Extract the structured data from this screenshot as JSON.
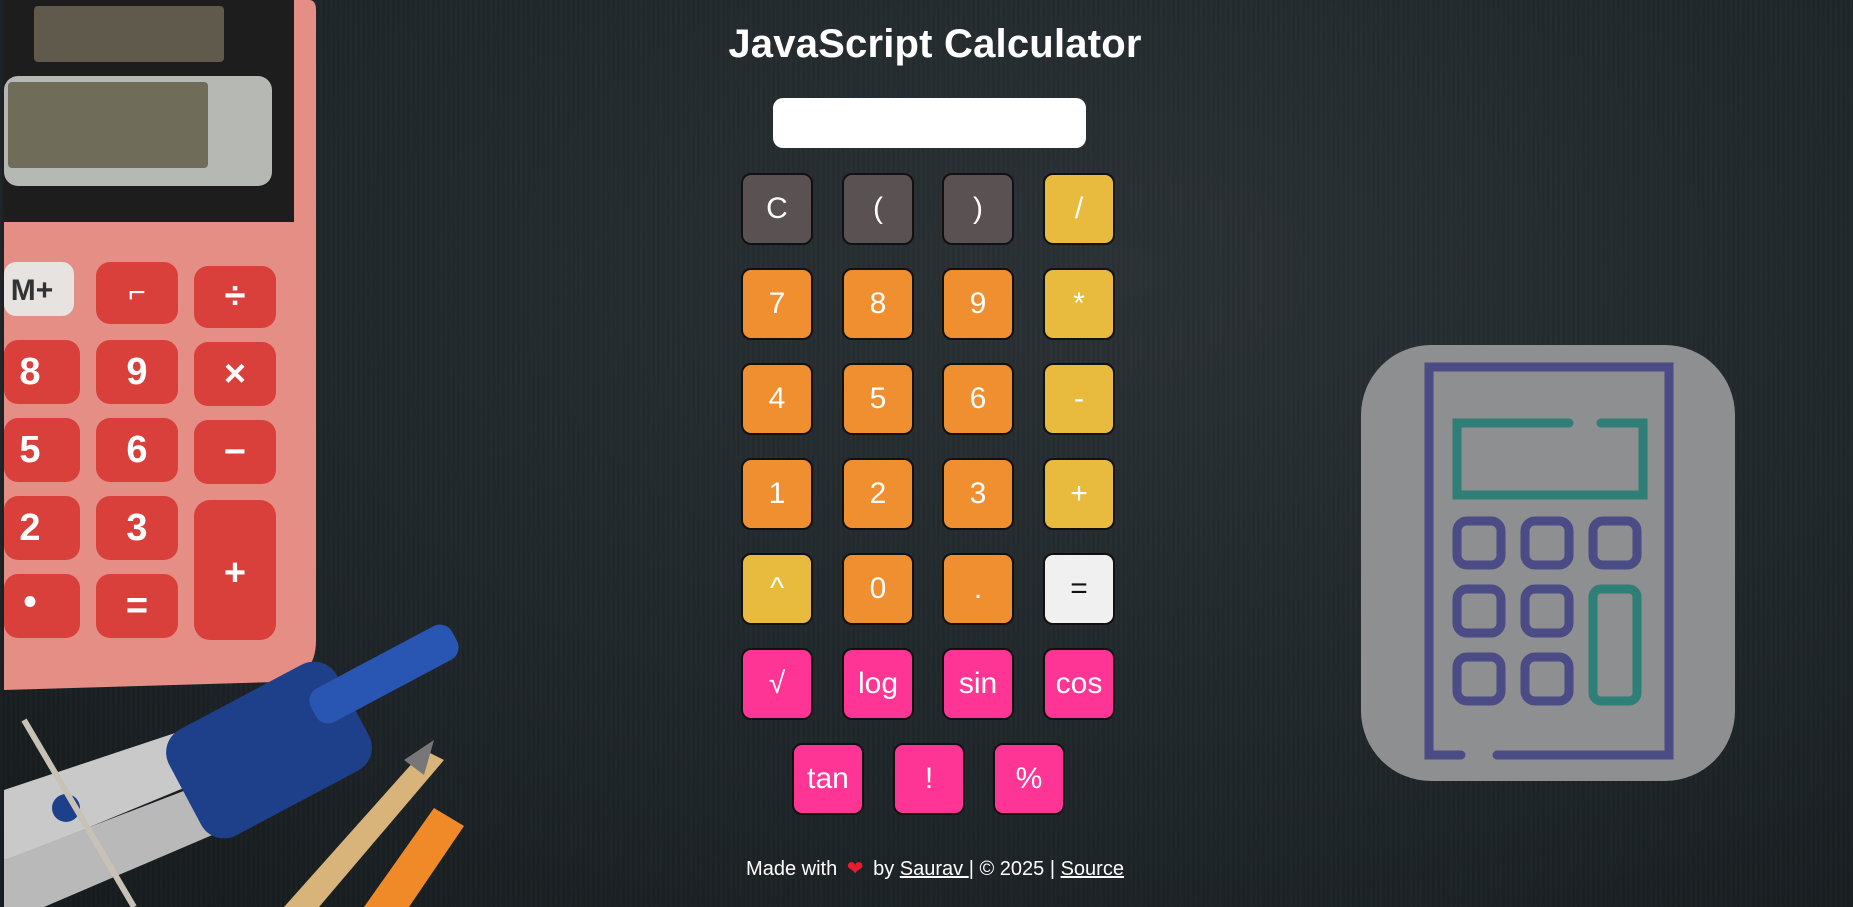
{
  "header": {
    "title": "JavaScript Calculator"
  },
  "display": {
    "value": "",
    "placeholder": ""
  },
  "keys": {
    "clear": "C",
    "lparen": "(",
    "rparen": ")",
    "divide": "/",
    "seven": "7",
    "eight": "8",
    "nine": "9",
    "multiply": "*",
    "four": "4",
    "five": "5",
    "six": "6",
    "minus": "-",
    "one": "1",
    "two": "2",
    "three": "3",
    "plus": "+",
    "power": "^",
    "zero": "0",
    "dot": ".",
    "equals": "=",
    "sqrt": "√",
    "log": "log",
    "sin": "sin",
    "cos": "cos",
    "tan": "tan",
    "factorial": "!",
    "percent": "%"
  },
  "footer": {
    "made_with": "Made with",
    "heart": "❤",
    "by": "by",
    "author": "Saurav ",
    "copyright": "| © 2025 |",
    "source": "Source"
  },
  "colors": {
    "dark": "#5a5153",
    "orange": "#ef8f2f",
    "yellow": "#e8bb3e",
    "white": "#f0f0f0",
    "pink": "#fe3594"
  }
}
